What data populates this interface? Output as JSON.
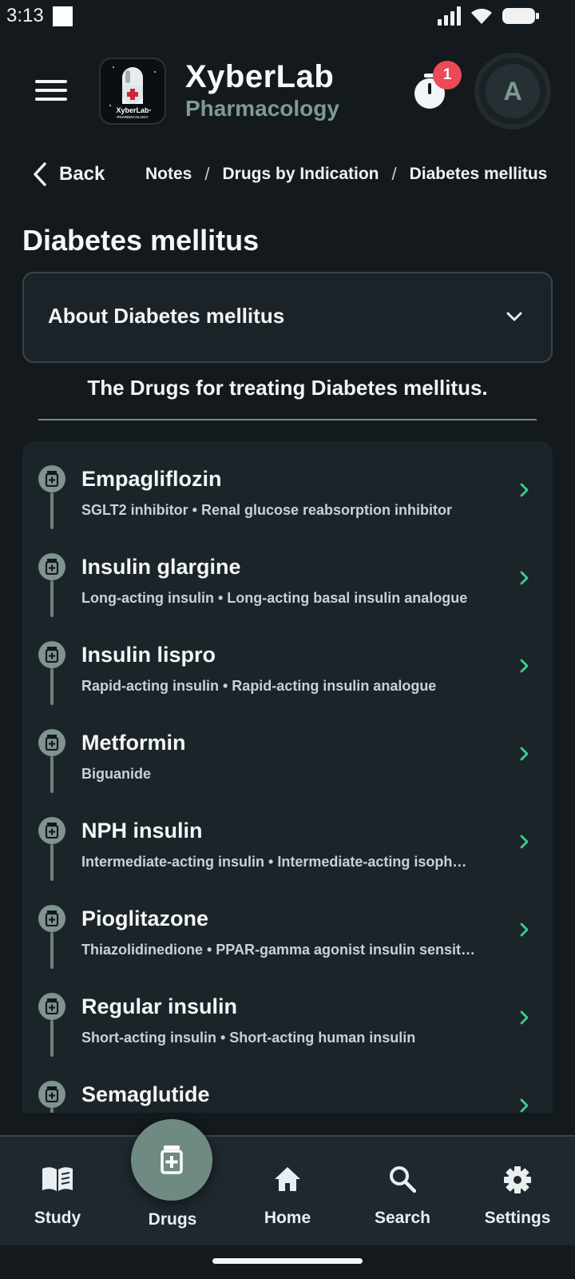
{
  "status": {
    "time": "3:13"
  },
  "header": {
    "app_title": "XyberLab",
    "app_subtitle": "Pharmacology",
    "logo_text": "XyberLab",
    "logo_subtext": "PHARMACOLOGY",
    "timer_badge_count": "1",
    "avatar_initial": "A"
  },
  "breadcrumb": {
    "back_label": "Back",
    "items": [
      "Notes",
      "Drugs by Indication",
      "Diabetes mellitus"
    ],
    "separator": "/"
  },
  "page": {
    "title": "Diabetes mellitus",
    "accordion_label": "About Diabetes mellitus",
    "section_heading": "The Drugs for treating Diabetes mellitus."
  },
  "drugs": [
    {
      "name": "Empagliflozin",
      "description": "SGLT2 inhibitor • Renal glucose reabsorption inhibitor"
    },
    {
      "name": "Insulin glargine",
      "description": "Long-acting insulin • Long-acting basal insulin analogue"
    },
    {
      "name": "Insulin lispro",
      "description": "Rapid-acting insulin • Rapid-acting insulin analogue"
    },
    {
      "name": "Metformin",
      "description": "Biguanide"
    },
    {
      "name": "NPH insulin",
      "description": "Intermediate-acting insulin • Intermediate-acting isoph…"
    },
    {
      "name": "Pioglitazone",
      "description": "Thiazolidinedione • PPAR-gamma agonist insulin sensit…"
    },
    {
      "name": "Regular insulin",
      "description": "Short-acting insulin • Short-acting human insulin"
    },
    {
      "name": "Semaglutide",
      "description": ""
    }
  ],
  "bottom_nav": {
    "study": "Study",
    "drugs": "Drugs",
    "home": "Home",
    "search": "Search",
    "settings": "Settings",
    "active": "drugs"
  },
  "colors": {
    "background": "#14191d",
    "accent": "#6f8a83",
    "chevron": "#3fce8f",
    "badge": "#ec4a57"
  }
}
